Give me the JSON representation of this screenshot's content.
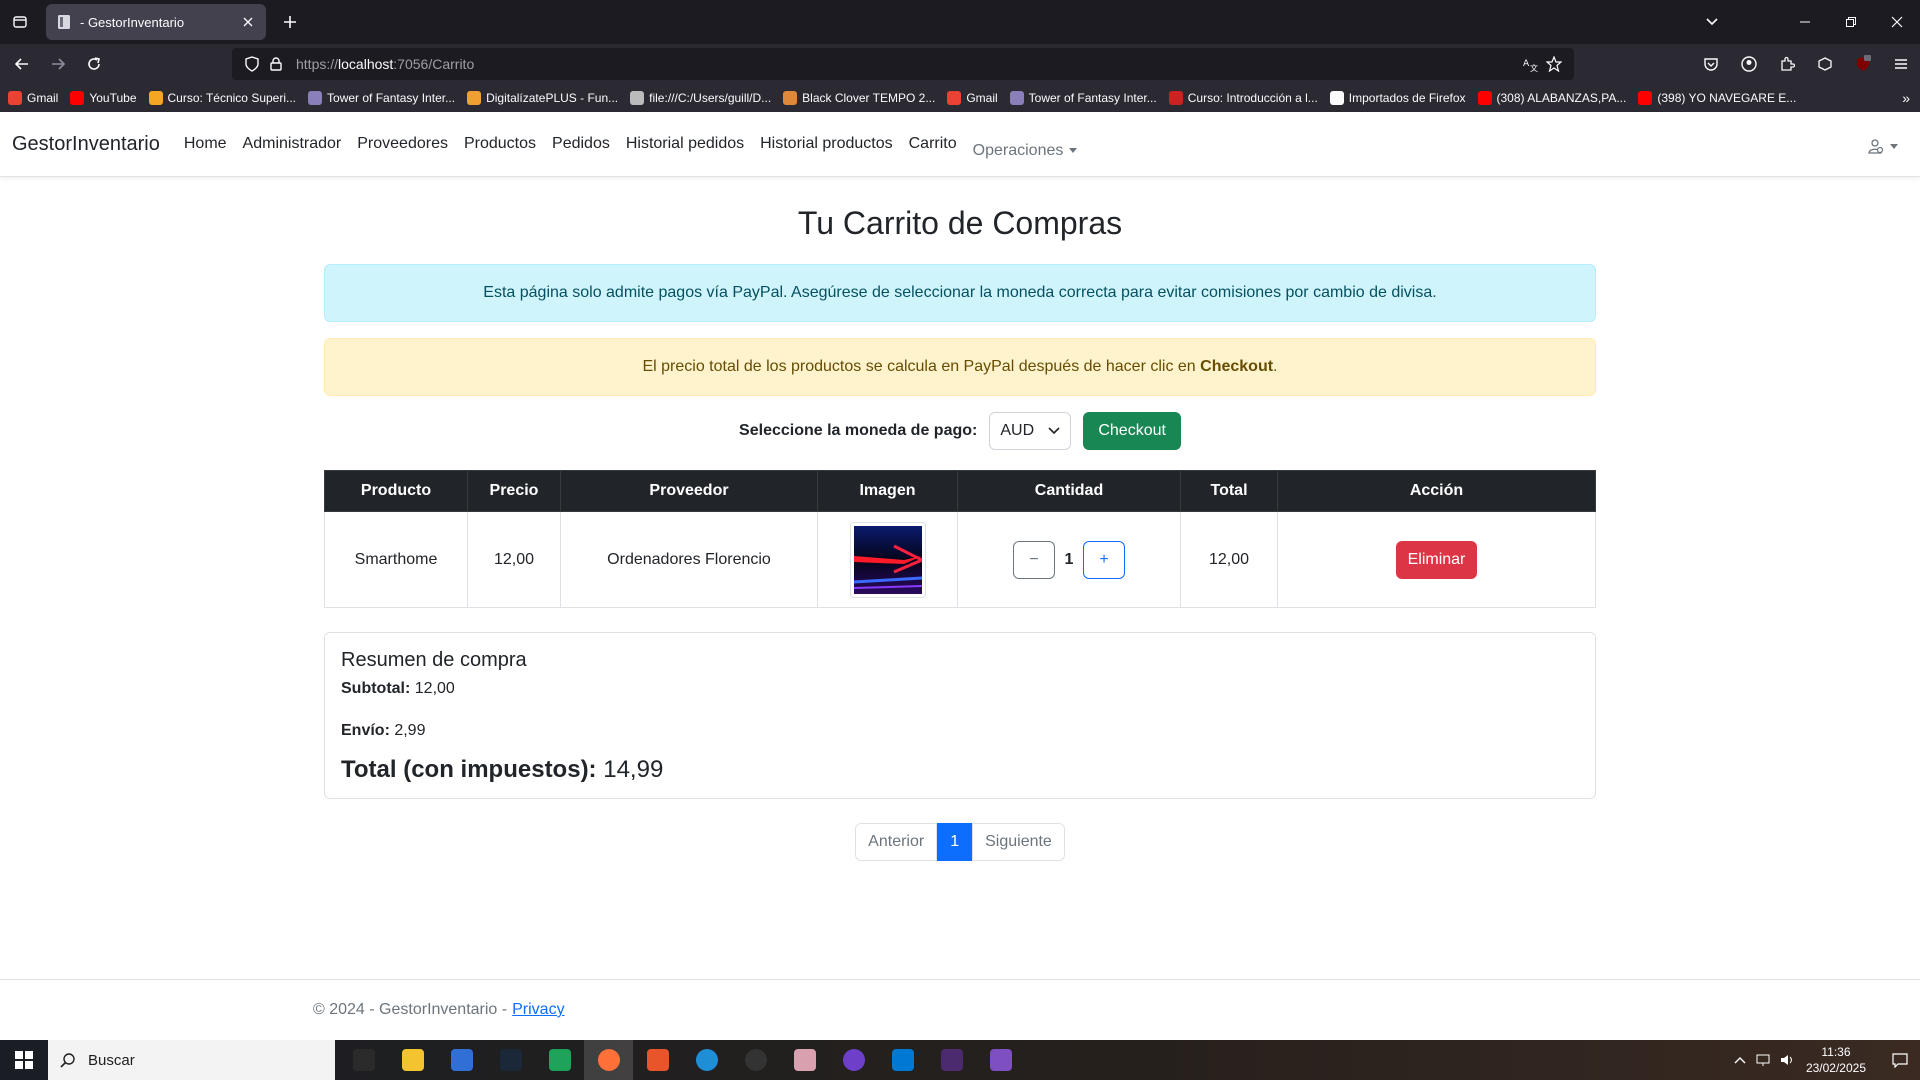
{
  "browser": {
    "tab_title": "- GestorInventario",
    "url_prefix": "https://",
    "url_host": "localhost",
    "url_rest": ":7056/Carrito",
    "bookmarks": [
      {
        "label": "Gmail",
        "color": "#ea4335"
      },
      {
        "label": "YouTube",
        "color": "#ff0000"
      },
      {
        "label": "Curso: Técnico Superi...",
        "color": "#f5a623"
      },
      {
        "label": "Tower of Fantasy Inter...",
        "color": "#8a7fb8"
      },
      {
        "label": "DigitalízatePLUS - Fun...",
        "color": "#f0a030"
      },
      {
        "label": "file:///C:/Users/guill/D...",
        "color": "#bbbbbb"
      },
      {
        "label": "Black Clover TEMPO 2...",
        "color": "#e0883a"
      },
      {
        "label": "Gmail",
        "color": "#ea4335"
      },
      {
        "label": "Tower of Fantasy Inter...",
        "color": "#8a7fb8"
      },
      {
        "label": "Curso: Introducción a l...",
        "color": "#cc2222"
      },
      {
        "label": "Importados de Firefox",
        "color": "#fbfbfe"
      },
      {
        "label": "(308) ALABANZAS,PA...",
        "color": "#ff0000"
      },
      {
        "label": "(398) YO NAVEGARE E...",
        "color": "#ff0000"
      }
    ]
  },
  "site": {
    "brand": "GestorInventario",
    "nav": [
      "Home",
      "Administrador",
      "Proveedores",
      "Productos",
      "Pedidos",
      "Historial pedidos",
      "Historial productos",
      "Carrito"
    ],
    "operaciones": "Operaciones"
  },
  "page": {
    "title": "Tu Carrito de Compras",
    "alert_info": "Esta página solo admite pagos vía PayPal. Asegúrese de seleccionar la moneda correcta para evitar comisiones por cambio de divisa.",
    "alert_warning_text": "El precio total de los productos se calcula en PayPal después de hacer clic en ",
    "alert_warning_bold": "Checkout",
    "alert_warning_end": ".",
    "currency_label": "Seleccione la moneda de pago:",
    "currency_value": "AUD",
    "checkout_label": "Checkout"
  },
  "table": {
    "headers": [
      "Producto",
      "Precio",
      "Proveedor",
      "Imagen",
      "Cantidad",
      "Total",
      "Acción"
    ],
    "rows": [
      {
        "producto": "Smarthome",
        "precio": "12,00",
        "proveedor": "Ordenadores Florencio",
        "cantidad": "1",
        "total": "12,00",
        "accion": "Eliminar"
      }
    ],
    "minus": "−",
    "plus": "+"
  },
  "summary": {
    "title": "Resumen de compra",
    "subtotal_label": "Subtotal:",
    "subtotal_value": " 12,00",
    "envio_label": "Envío:",
    "envio_value": " 2,99",
    "total_label": "Total (con impuestos):",
    "total_value": " 14,99"
  },
  "pagination": {
    "prev": "Anterior",
    "current": "1",
    "next": "Siguiente"
  },
  "footer": {
    "text": "© 2024 - GestorInventario -",
    "link": "Privacy"
  },
  "taskbar": {
    "search": "Buscar",
    "time": "11:36",
    "date": "23/02/2025",
    "apps": [
      {
        "name": "task-view",
        "color": "#2b2b2b"
      },
      {
        "name": "file-explorer",
        "color": "#f4c430"
      },
      {
        "name": "store",
        "color": "#2f6fd6"
      },
      {
        "name": "steam",
        "color": "#1b2838"
      },
      {
        "name": "app-green",
        "color": "#1fa35b"
      },
      {
        "name": "firefox",
        "color": "#ff7139"
      },
      {
        "name": "dts",
        "color": "#e8552b"
      },
      {
        "name": "edge",
        "color": "#1e8fd6"
      },
      {
        "name": "obs",
        "color": "#333333"
      },
      {
        "name": "anime-app",
        "color": "#d9a0b0"
      },
      {
        "name": "github",
        "color": "#6e40c9"
      },
      {
        "name": "vscode",
        "color": "#0078d4"
      },
      {
        "name": "terminal",
        "color": "#4b2a6e"
      },
      {
        "name": "visual-studio",
        "color": "#7e4fc1"
      }
    ]
  }
}
